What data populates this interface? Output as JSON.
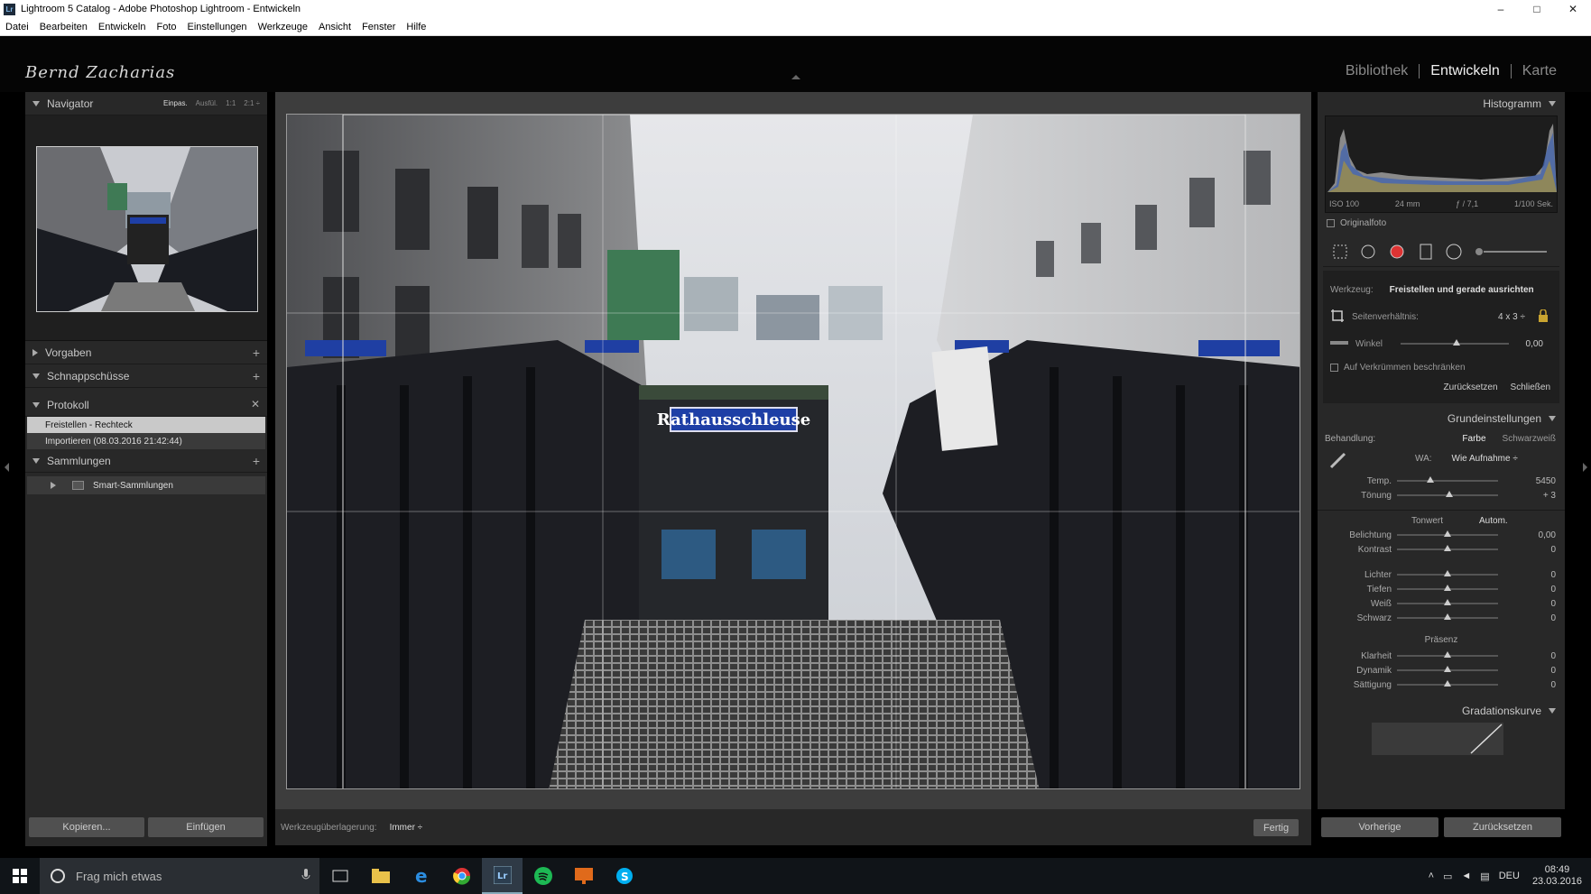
{
  "window": {
    "title": "Lightroom 5 Catalog - Adobe Photoshop Lightroom - Entwickeln",
    "controls": [
      "–",
      "□",
      "✕"
    ]
  },
  "menu": [
    "Datei",
    "Bearbeiten",
    "Entwickeln",
    "Foto",
    "Einstellungen",
    "Werkzeuge",
    "Ansicht",
    "Fenster",
    "Hilfe"
  ],
  "identity_plate": "Bernd Zacharias",
  "modules": [
    "Bibliothek",
    "Entwickeln",
    "Karte"
  ],
  "left": {
    "navigator": {
      "title": "Navigator",
      "options": [
        "Einpas.",
        "Ausfül.",
        "1:1",
        "2:1 ÷"
      ]
    },
    "presets": "Vorgaben",
    "snapshots": "Schnappschüsse",
    "history": {
      "title": "Protokoll",
      "items": [
        "Freistellen - Rechteck",
        "Importieren (08.03.2016 21:42:44)"
      ]
    },
    "collections": {
      "title": "Sammlungen",
      "items": [
        "Smart-Sammlungen"
      ]
    },
    "copy_button": "Kopieren...",
    "paste_button": "Einfügen"
  },
  "photo": {
    "sign_text": "Rathausschleuse"
  },
  "toolbar": {
    "overlay_label": "Werkzeugüberlagerung:",
    "overlay_value": "Immer ÷",
    "done_button": "Fertig"
  },
  "right": {
    "histogram": {
      "title": "Histogramm",
      "iso": "ISO 100",
      "focal": "24 mm",
      "aperture": "ƒ / 7,1",
      "shutter": "1/100 Sek."
    },
    "original_photo": "Originalfoto",
    "crop": {
      "tool_label": "Werkzeug:",
      "tool_value": "Freistellen und gerade ausrichten",
      "aspect_label": "Seitenverhältnis:",
      "aspect_value": "4 x 3 ÷",
      "angle_label": "Winkel",
      "angle_value": "0,00",
      "constrain_label": "Auf Verkrümmen beschränken",
      "reset_button": "Zurücksetzen",
      "close_button": "Schließen"
    },
    "basic": {
      "title": "Grundeinstellungen",
      "treatment_label": "Behandlung:",
      "treatment_color": "Farbe",
      "treatment_bw": "Schwarzweiß",
      "wb_label": "WA:",
      "wb_value": "Wie Aufnahme ÷",
      "tone_label": "Tonwert",
      "auto_button": "Autom.",
      "presence_label": "Präsenz",
      "sliders_wb": [
        {
          "label": "Temp.",
          "value": "5450",
          "pos": 0.33
        },
        {
          "label": "Tönung",
          "value": "+ 3",
          "pos": 0.52
        }
      ],
      "sliders_tone": [
        {
          "label": "Belichtung",
          "value": "0,00",
          "pos": 0.5
        },
        {
          "label": "Kontrast",
          "value": "0",
          "pos": 0.5
        }
      ],
      "sliders_tone2": [
        {
          "label": "Lichter",
          "value": "0",
          "pos": 0.5
        },
        {
          "label": "Tiefen",
          "value": "0",
          "pos": 0.5
        },
        {
          "label": "Weiß",
          "value": "0",
          "pos": 0.5
        },
        {
          "label": "Schwarz",
          "value": "0",
          "pos": 0.5
        }
      ],
      "sliders_presence": [
        {
          "label": "Klarheit",
          "value": "0",
          "pos": 0.5
        },
        {
          "label": "Dynamik",
          "value": "0",
          "pos": 0.5
        },
        {
          "label": "Sättigung",
          "value": "0",
          "pos": 0.5
        }
      ]
    },
    "tone_curve": "Gradationskurve",
    "prev_button": "Vorherige",
    "reset_button": "Zurücksetzen"
  },
  "taskbar": {
    "search_placeholder": "Frag mich etwas",
    "lang": "DEU",
    "time": "08:49",
    "date": "23.03.2016"
  }
}
